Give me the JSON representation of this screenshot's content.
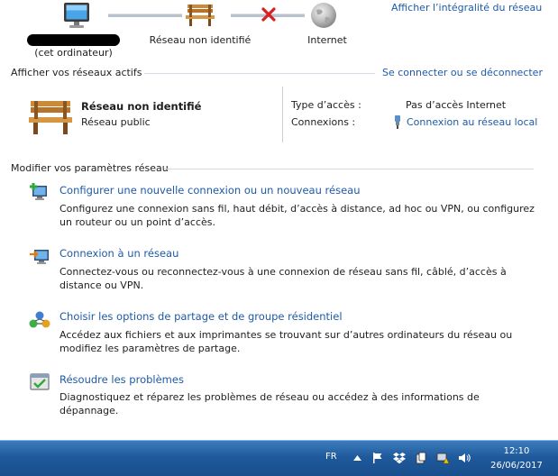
{
  "map": {
    "computer_label": "(cet ordinateur)",
    "network_label": "Réseau non identifié",
    "internet_label": "Internet",
    "show_full_map": "Afficher l’intégralité du réseau"
  },
  "active": {
    "heading": "Afficher vos réseaux actifs",
    "connect_link": "Se connecter ou se déconnecter",
    "network_name": "Réseau non identifié",
    "network_type": "Réseau public",
    "access_type_label": "Type d’accès :",
    "access_type_value": "Pas d’accès Internet",
    "connections_label": "Connexions :",
    "connections_value": "Connexion au réseau local"
  },
  "settings": {
    "heading": "Modifier vos paramètres réseau",
    "tasks": [
      {
        "title": "Configurer une nouvelle connexion ou un nouveau réseau",
        "desc": "Configurez une connexion sans fil, haut débit, d’accès à distance, ad hoc ou VPN, ou configurez un routeur ou un point d’accès.",
        "icon": "new-connection-icon"
      },
      {
        "title": "Connexion à un réseau",
        "desc": "Connectez-vous ou reconnectez-vous à une connexion de réseau sans fil, câblé, d’accès à distance ou VPN.",
        "icon": "connect-network-icon"
      },
      {
        "title": "Choisir les options de partage et de groupe résidentiel",
        "desc": "Accédez aux fichiers et aux imprimantes se trouvant sur d’autres ordinateurs du réseau ou modifiez les paramètres de partage.",
        "icon": "homegroup-icon"
      },
      {
        "title": "Résoudre les problèmes",
        "desc": "Diagnostiquez et réparez les problèmes de réseau ou accédez à des informations de dépannage.",
        "icon": "troubleshoot-icon"
      }
    ]
  },
  "taskbar": {
    "language": "FR",
    "time": "12:10",
    "date": "26/06/2017"
  },
  "colors": {
    "link": "#1e5aa8",
    "taskbar": "#1f5a9c",
    "error_x": "#d92020"
  }
}
